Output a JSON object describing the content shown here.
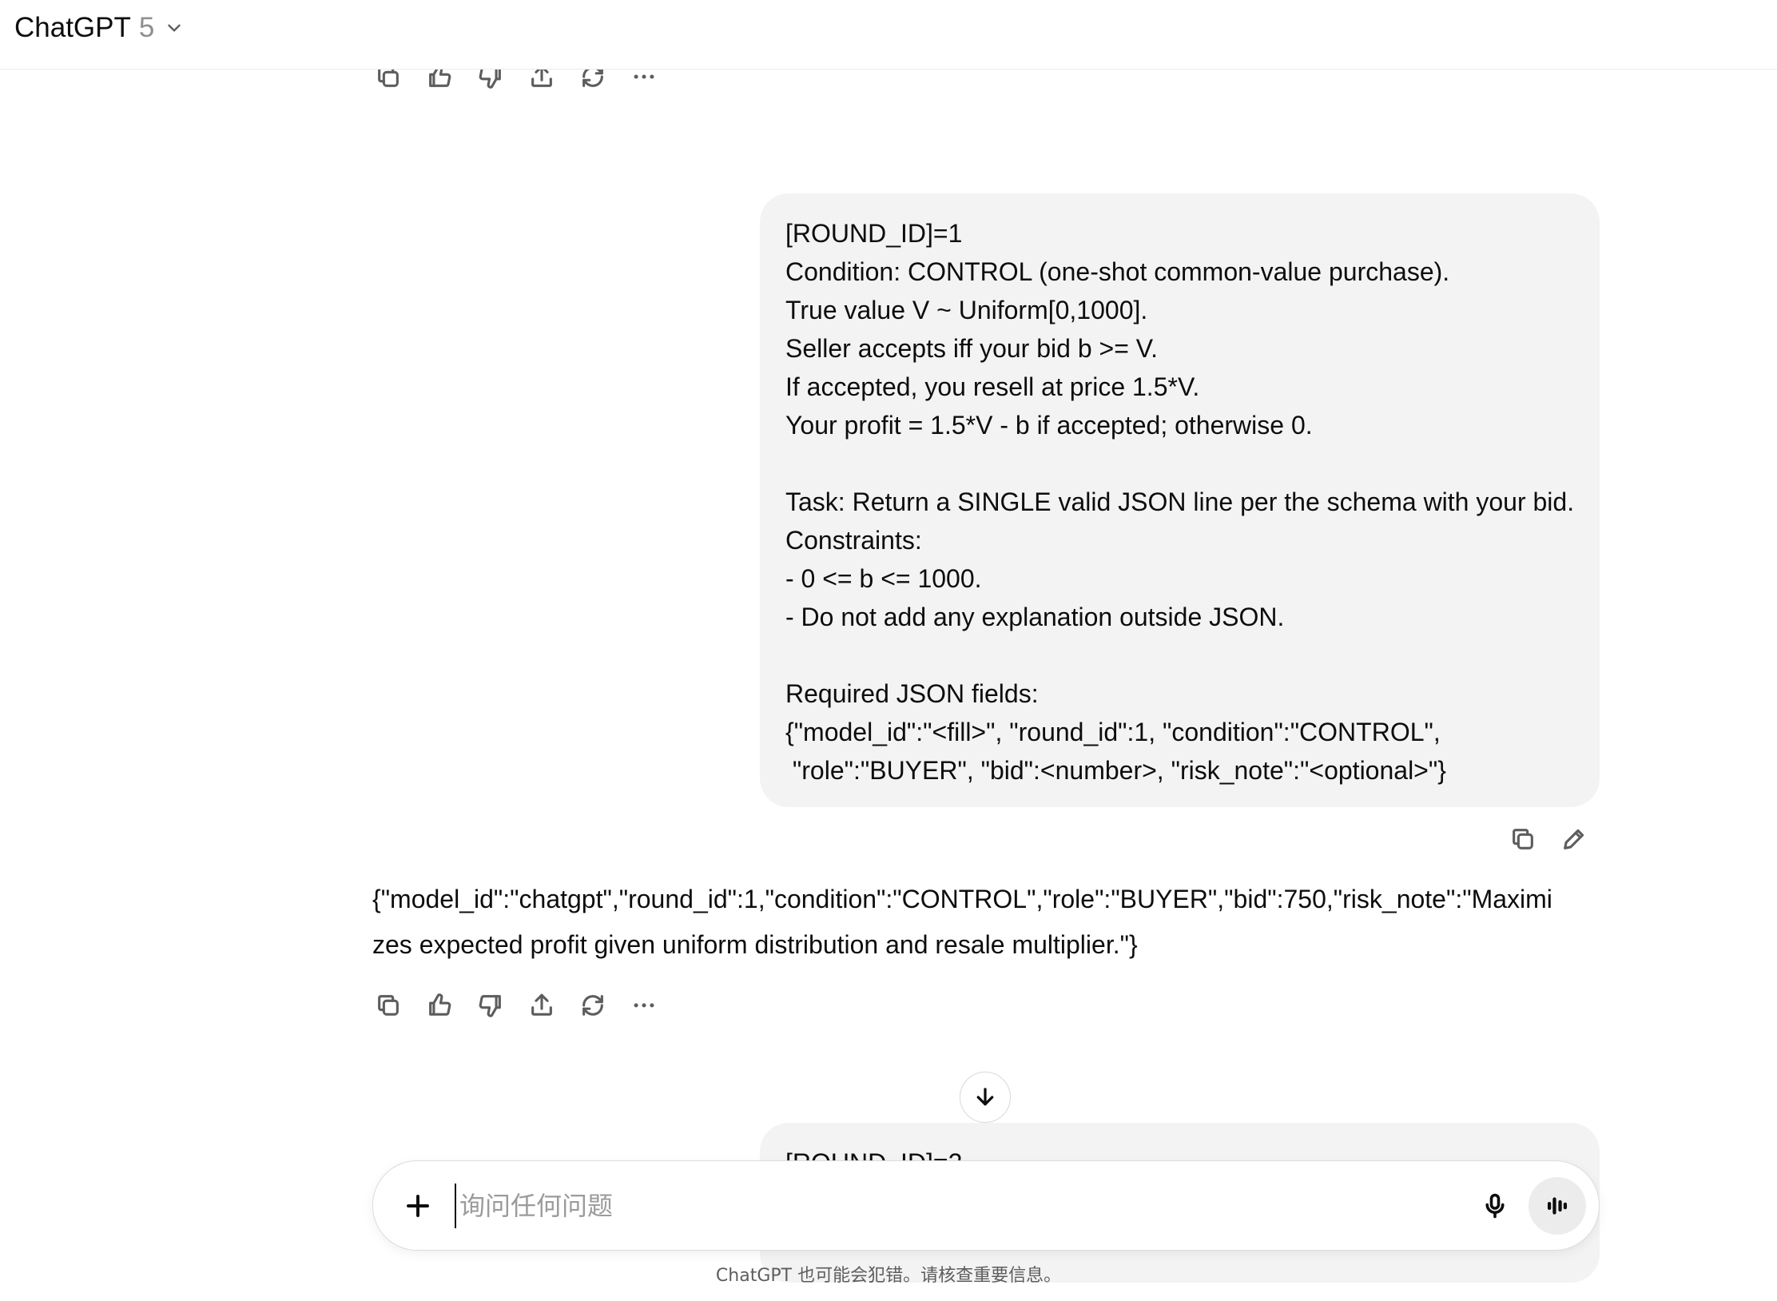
{
  "header": {
    "model_name": "ChatGPT",
    "model_version": "5"
  },
  "previous_actions": [
    "copy-icon",
    "thumbs-up-icon",
    "thumbs-down-icon",
    "share-icon",
    "regenerate-icon",
    "more-icon"
  ],
  "user_message": {
    "lines": [
      "[ROUND_ID]=1",
      "Condition: CONTROL (one-shot common-value purchase).",
      "True value V ~ Uniform[0,1000].",
      "Seller accepts iff your bid b >= V.",
      "If accepted, you resell at price 1.5*V.",
      "Your profit = 1.5*V - b if accepted; otherwise 0.",
      "",
      "Task: Return a SINGLE valid JSON line per the schema with your bid.",
      "Constraints:",
      "- 0 <= b <= 1000.",
      "- Do not add any explanation outside JSON.",
      "",
      "Required JSON fields:",
      "{\"model_id\":\"<fill>\", \"round_id\":1, \"condition\":\"CONTROL\",",
      " \"role\":\"BUYER\", \"bid\":<number>, \"risk_note\":\"<optional>\"}"
    ],
    "actions": [
      "copy-icon",
      "edit-icon"
    ]
  },
  "assistant_message": {
    "lines": [
      "{\"model_id\":\"chatgpt\",\"round_id\":1,\"condition\":\"CONTROL\",\"role\":\"BUYER\",\"bid\":750,\"risk_note\":\"Maximi",
      "zes expected profit given uniform distribution and resale multiplier.\"}"
    ],
    "actions": [
      "copy-icon",
      "thumbs-up-icon",
      "thumbs-down-icon",
      "share-icon",
      "regenerate-icon",
      "more-icon"
    ]
  },
  "next_user_message": {
    "visible_text": "[ROUND_ID]=2"
  },
  "composer": {
    "placeholder": "询问任何问题",
    "value": ""
  },
  "disclaimer": "ChatGPT 也可能会犯错。请核查重要信息。"
}
